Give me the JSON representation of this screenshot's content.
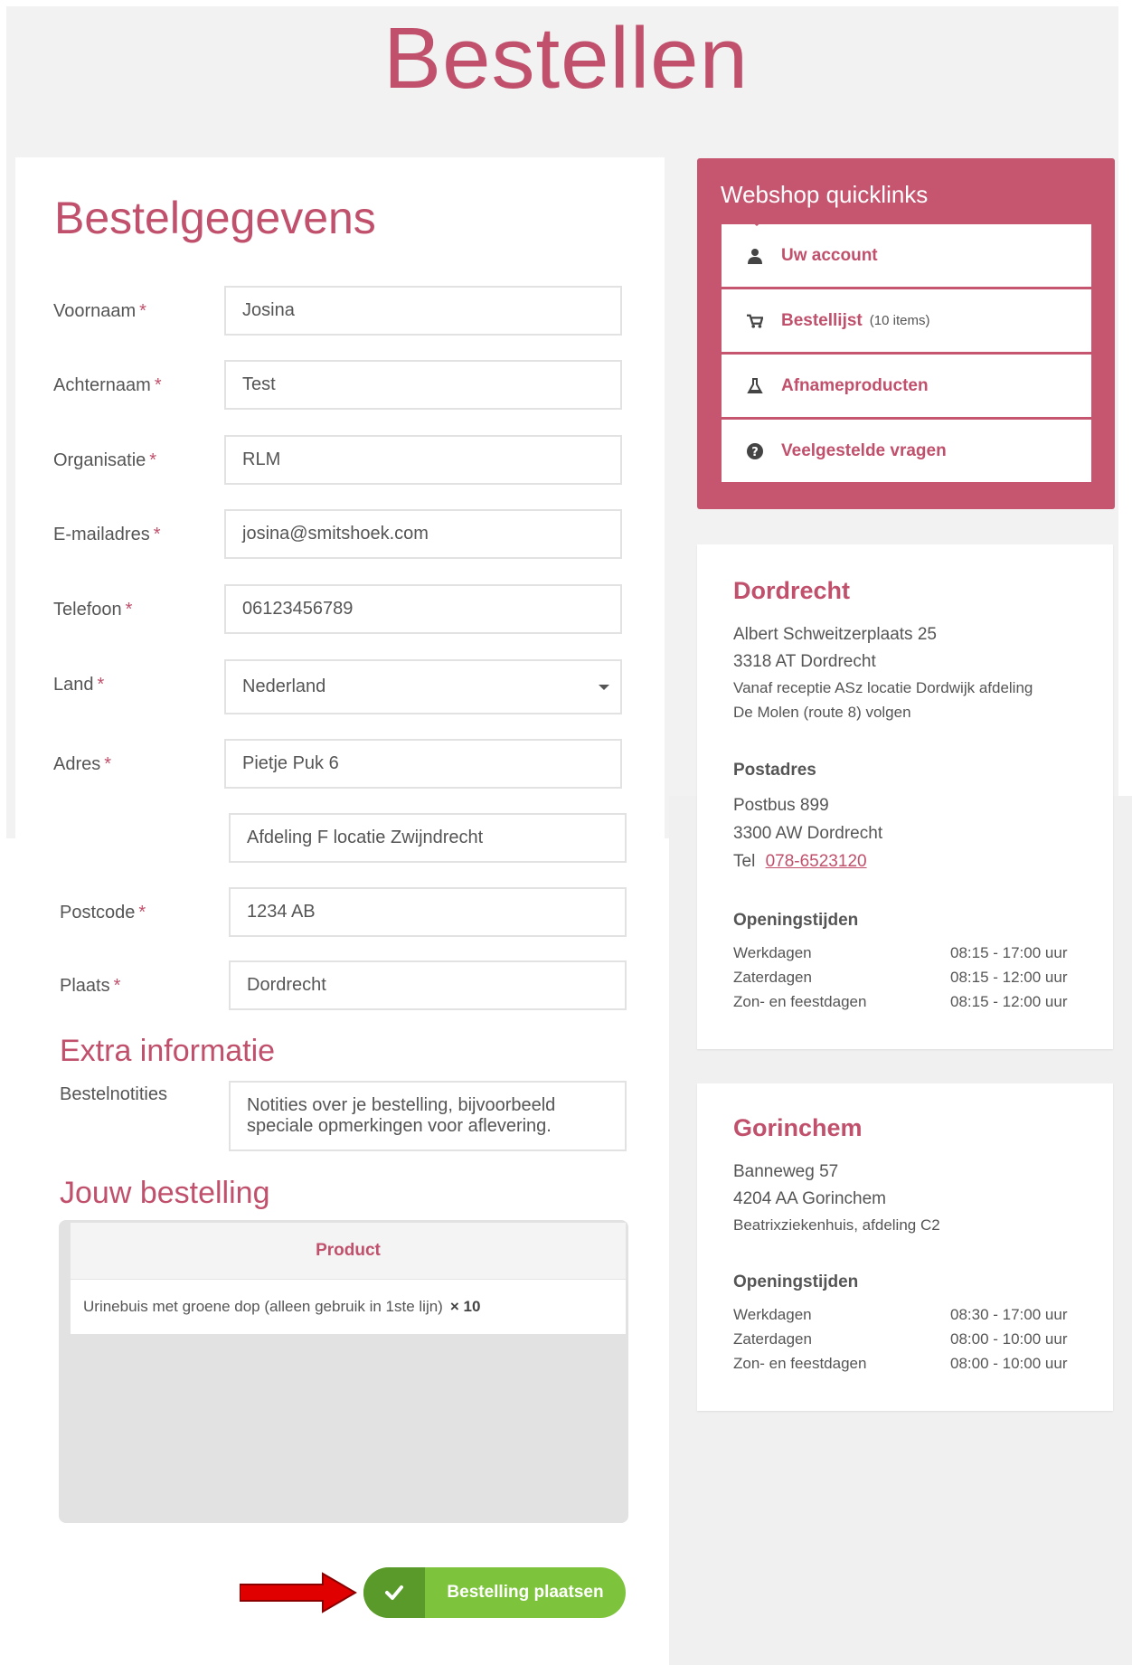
{
  "page": {
    "title": "Bestellen"
  },
  "form": {
    "heading": "Bestelgegevens",
    "required_mark": "*",
    "fields": {
      "voornaam": {
        "label": "Voornaam",
        "value": "Josina"
      },
      "achternaam": {
        "label": "Achternaam",
        "value": "Test"
      },
      "organisatie": {
        "label": "Organisatie",
        "value": "RLM"
      },
      "email": {
        "label": "E-mailadres",
        "value": "josina@smitshoek.com"
      },
      "telefoon": {
        "label": "Telefoon",
        "value": "06123456789"
      },
      "land": {
        "label": "Land",
        "value": "Nederland"
      },
      "adres": {
        "label": "Adres",
        "value": "Pietje Puk 6",
        "value2": "Afdeling F locatie Zwijndrecht"
      },
      "postcode": {
        "label": "Postcode",
        "value": "1234 AB"
      },
      "plaats": {
        "label": "Plaats",
        "value": "Dordrecht"
      }
    },
    "extra": {
      "heading": "Extra informatie",
      "notes_label": "Bestelnotities",
      "notes_placeholder": "Notities over je bestelling, bijvoorbeeld\nspeciale opmerkingen voor aflevering."
    },
    "order": {
      "heading": "Jouw bestelling",
      "column_header": "Product",
      "items": [
        {
          "name": "Urinebuis met groene dop (alleen gebruik in 1ste lijn)",
          "qty": "× 10"
        }
      ]
    },
    "submit_label": "Bestelling plaatsen",
    "submit_icon": "check-icon"
  },
  "quicklinks": {
    "title": "Webshop quicklinks",
    "items": [
      {
        "label": "Uw account",
        "icon": "user-icon"
      },
      {
        "label": "Bestellijst",
        "count": "(10 items)",
        "icon": "cart-icon"
      },
      {
        "label": "Afnameproducten",
        "icon": "flask-icon"
      },
      {
        "label": "Veelgestelde vragen",
        "icon": "question-icon"
      }
    ]
  },
  "dordrecht": {
    "title": "Dordrecht",
    "address1": "Albert Schweitzerplaats 25",
    "address2": "3318 AT Dordrecht",
    "directions1": "Vanaf receptie ASz locatie Dordwijk afdeling",
    "directions2": "De Molen (route 8) volgen",
    "postadres_heading": "Postadres",
    "post1": "Postbus 899",
    "post2": "3300 AW Dordrecht",
    "tel_label": "Tel",
    "tel": "078-6523120",
    "hours_heading": "Openingstijden",
    "hours": [
      {
        "day": "Werkdagen",
        "time": "08:15 - 17:00 uur"
      },
      {
        "day": "Zaterdagen",
        "time": "08:15 - 12:00 uur"
      },
      {
        "day": "Zon- en feestdagen",
        "time": "08:15 - 12:00 uur"
      }
    ]
  },
  "gorinchem": {
    "title": "Gorinchem",
    "address1": "Banneweg 57",
    "address2": "4204 AA Gorinchem",
    "directions1": "Beatrixziekenhuis, afdeling C2",
    "hours_heading": "Openingstijden",
    "hours": [
      {
        "day": "Werkdagen",
        "time": "08:30 - 17:00 uur"
      },
      {
        "day": "Zaterdagen",
        "time": "08:00 - 10:00 uur"
      },
      {
        "day": "Zon- en feestdagen",
        "time": "08:00 - 10:00 uur"
      }
    ]
  },
  "colors": {
    "accent": "#c0506b",
    "panel": "#c65670",
    "button": "#7dc43c",
    "button_dark": "#5a9a2a",
    "arrow": "#e00000"
  }
}
